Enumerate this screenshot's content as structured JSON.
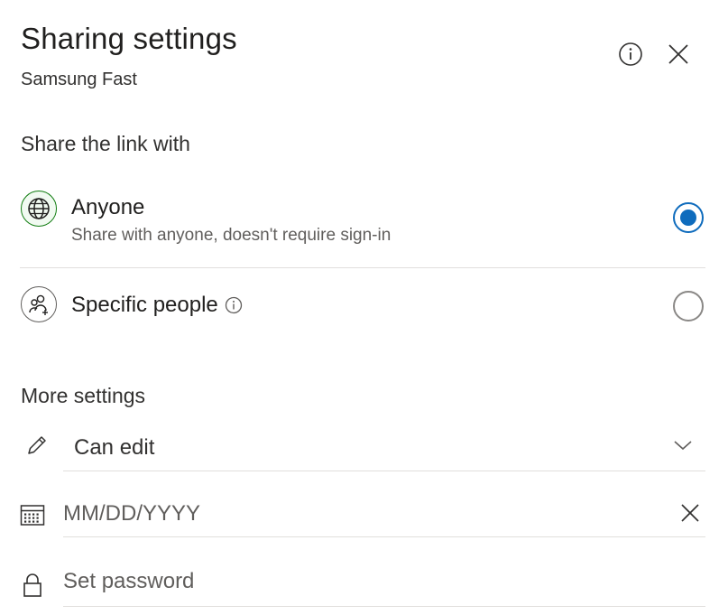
{
  "header": {
    "title": "Sharing settings",
    "subtitle": "Samsung Fast",
    "info_icon": "info-icon",
    "close_icon": "close-icon"
  },
  "share_section": {
    "heading": "Share the link with",
    "options": [
      {
        "label": "Anyone",
        "description": "Share with anyone, doesn't require sign-in",
        "icon": "globe-icon",
        "selected": true
      },
      {
        "label": "Specific people",
        "icon": "people-icon",
        "info_icon": "info-icon",
        "selected": false
      }
    ]
  },
  "more_settings": {
    "heading": "More settings",
    "permission": {
      "label": "Can edit",
      "icon": "pencil-icon",
      "dropdown_icon": "chevron-down-icon"
    },
    "expiration": {
      "placeholder": "MM/DD/YYYY",
      "value": "",
      "icon": "calendar-icon",
      "clear_icon": "close-icon"
    },
    "password": {
      "placeholder": "Set password",
      "value": "",
      "icon": "lock-icon"
    }
  },
  "colors": {
    "accent": "#0f6cbd",
    "globe": "#107c10",
    "divider": "#e1dfdd"
  }
}
